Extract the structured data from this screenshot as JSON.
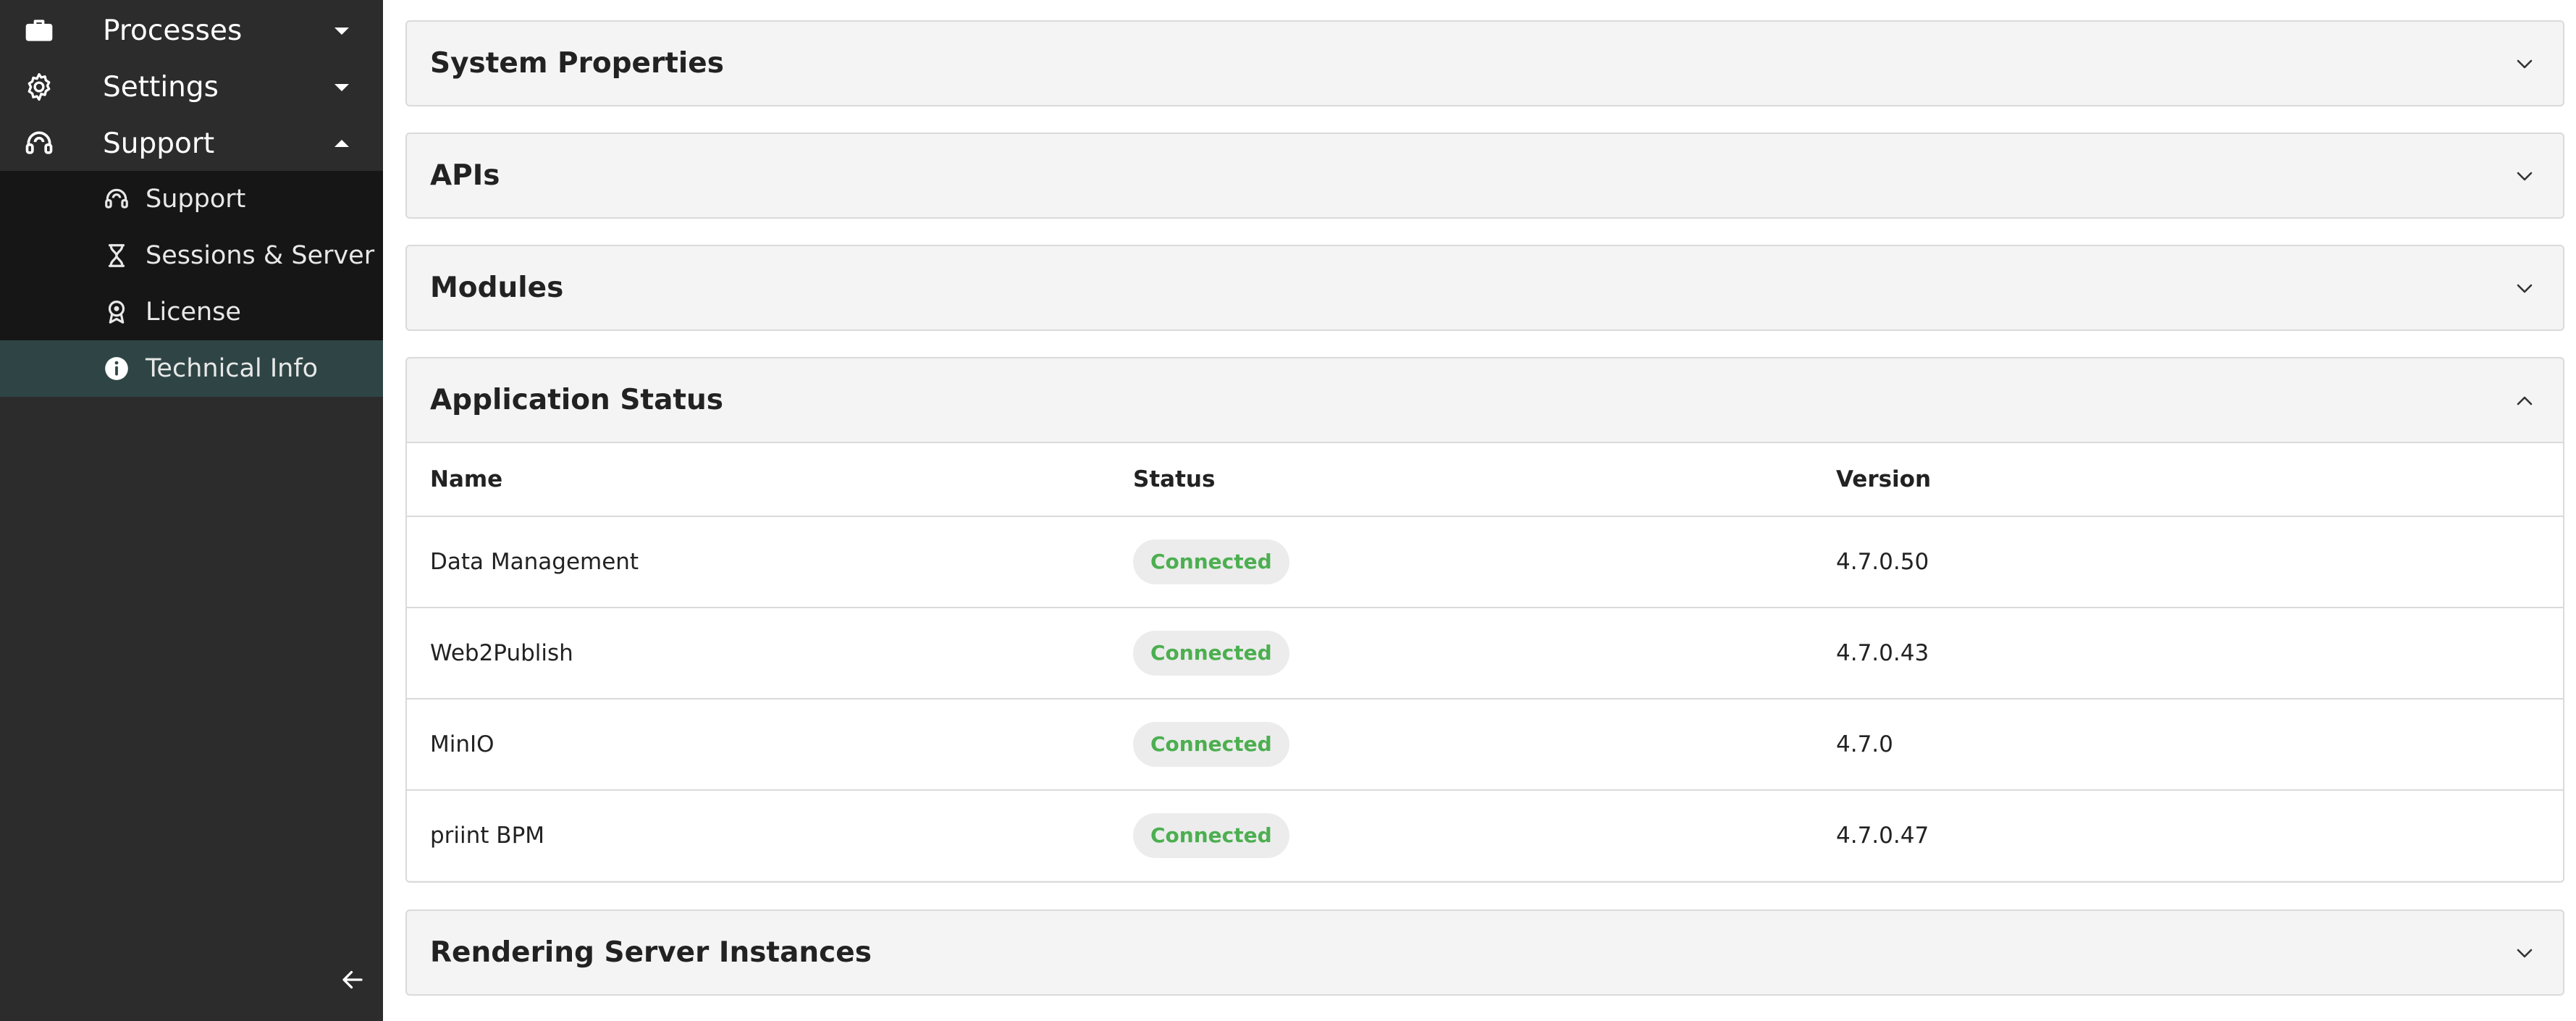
{
  "sidebar": {
    "items": [
      {
        "label": "Processes",
        "icon": "briefcase-icon",
        "expanded": false
      },
      {
        "label": "Settings",
        "icon": "gear-icon",
        "expanded": false
      },
      {
        "label": "Support",
        "icon": "headset-icon",
        "expanded": true
      }
    ],
    "support_submenu": [
      {
        "label": "Support",
        "icon": "headset-icon",
        "active": false
      },
      {
        "label": "Sessions & Server",
        "icon": "hourglass-icon",
        "active": false
      },
      {
        "label": "License",
        "icon": "award-icon",
        "active": false
      },
      {
        "label": "Technical Info",
        "icon": "info-icon",
        "active": true
      }
    ],
    "collapse_icon": "arrow-left-icon"
  },
  "panels": {
    "system_properties": {
      "title": "System Properties",
      "expanded": false
    },
    "apis": {
      "title": "APIs",
      "expanded": false
    },
    "modules": {
      "title": "Modules",
      "expanded": false
    },
    "application_status": {
      "title": "Application Status",
      "expanded": true,
      "columns": {
        "name": "Name",
        "status": "Status",
        "version": "Version"
      },
      "rows": [
        {
          "name": "Data Management",
          "status": "Connected",
          "version": "4.7.0.50"
        },
        {
          "name": "Web2Publish",
          "status": "Connected",
          "version": "4.7.0.43"
        },
        {
          "name": "MinIO",
          "status": "Connected",
          "version": "4.7.0"
        },
        {
          "name": "priint BPM",
          "status": "Connected",
          "version": "4.7.0.47"
        }
      ]
    },
    "rendering_server_instances": {
      "title": "Rendering Server Instances",
      "expanded": false
    }
  },
  "colors": {
    "sidebar_bg": "#2c2c2c",
    "submenu_bg": "#161616",
    "active_item_bg": "#2f4545",
    "status_connected": "#4caf50",
    "panel_header_bg": "#f4f4f4"
  }
}
